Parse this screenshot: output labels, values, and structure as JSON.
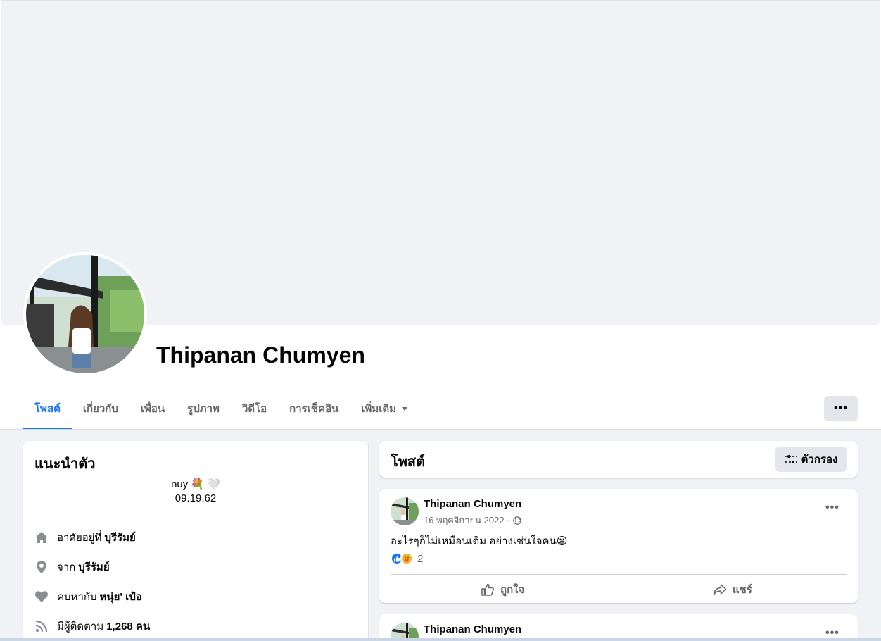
{
  "profile": {
    "name": "Thipanan Chumyen"
  },
  "tabs": [
    {
      "label": "โพสต์"
    },
    {
      "label": "เกี่ยวกับ"
    },
    {
      "label": "เพื่อน"
    },
    {
      "label": "รูปภาพ"
    },
    {
      "label": "วิดีโอ"
    },
    {
      "label": "การเช็คอิน"
    },
    {
      "label": "เพิ่มเติม"
    }
  ],
  "more_button": {
    "label": "•••"
  },
  "intro": {
    "title": "แนะนำตัว",
    "bio_line1": "nuy 💐 🤍",
    "bio_line2": "09.19.62",
    "items": [
      {
        "icon": "home-icon",
        "prefix": "อาศัยอยู่ที่",
        "value": "บุรีรัมย์"
      },
      {
        "icon": "location-pin-icon",
        "prefix": "จาก",
        "value": "บุรีรัมย์"
      },
      {
        "icon": "heart-icon",
        "prefix": "คบหากับ",
        "value": "หนุ่ย' เป๋อ"
      },
      {
        "icon": "rss-icon",
        "prefix": "มีผู้ติดตาม",
        "value": "1,268 คน"
      }
    ]
  },
  "posts": {
    "title": "โพสต์",
    "filter_label": "ตัวกรอง",
    "items": [
      {
        "author": "Thipanan Chumyen",
        "date": "16 พฤศจิกายน 2022 ·",
        "text": "อะไรๆก็ไม่เหมือนเดิม อย่างเช่นใจคน",
        "emoji": "😦",
        "reaction_count": "2",
        "like_label": "ถูกใจ",
        "share_label": "แชร์",
        "menu_label": "•••"
      },
      {
        "author": "Thipanan Chumyen",
        "menu_label": "•••"
      }
    ]
  },
  "colors": {
    "accent": "#1877f2",
    "secondary_text": "#65676b",
    "button_bg": "#e4e6eb",
    "page_bg": "#f0f2f5"
  }
}
